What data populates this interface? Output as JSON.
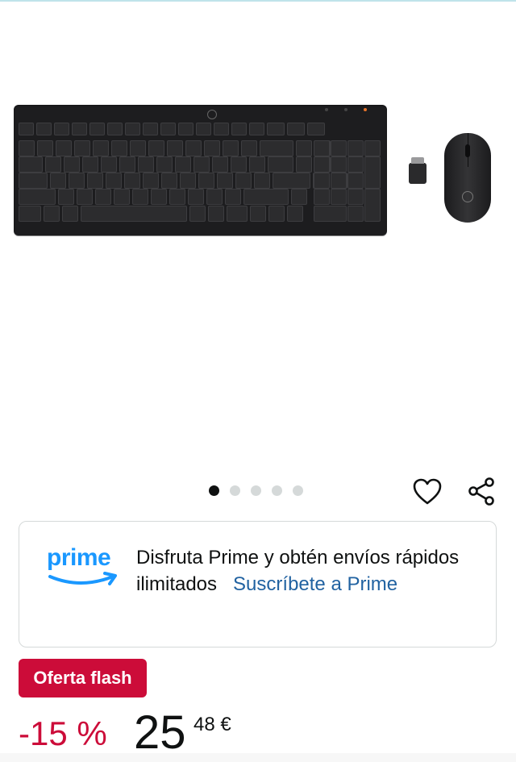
{
  "product": {
    "image_alt": "",
    "carousel": {
      "count": 5,
      "active": 0
    }
  },
  "prime": {
    "logo_text": "prime",
    "message": "Disfruta Prime y obtén envíos rápidos ilimitados",
    "link": "Suscríbete a Prime"
  },
  "deal": {
    "badge": "Oferta flash"
  },
  "price": {
    "discount": "-15 %",
    "whole": "25",
    "fraction": "48 €"
  },
  "icons": {
    "wishlist": "heart-icon",
    "share": "share-icon",
    "prime_smile": "prime-smile-icon"
  },
  "colors": {
    "deal_red": "#cc0c39",
    "prime_blue": "#1a98ff",
    "link_blue": "#2162a1",
    "dot_active": "#0f1111",
    "dot_inactive": "#d5d9d9"
  }
}
